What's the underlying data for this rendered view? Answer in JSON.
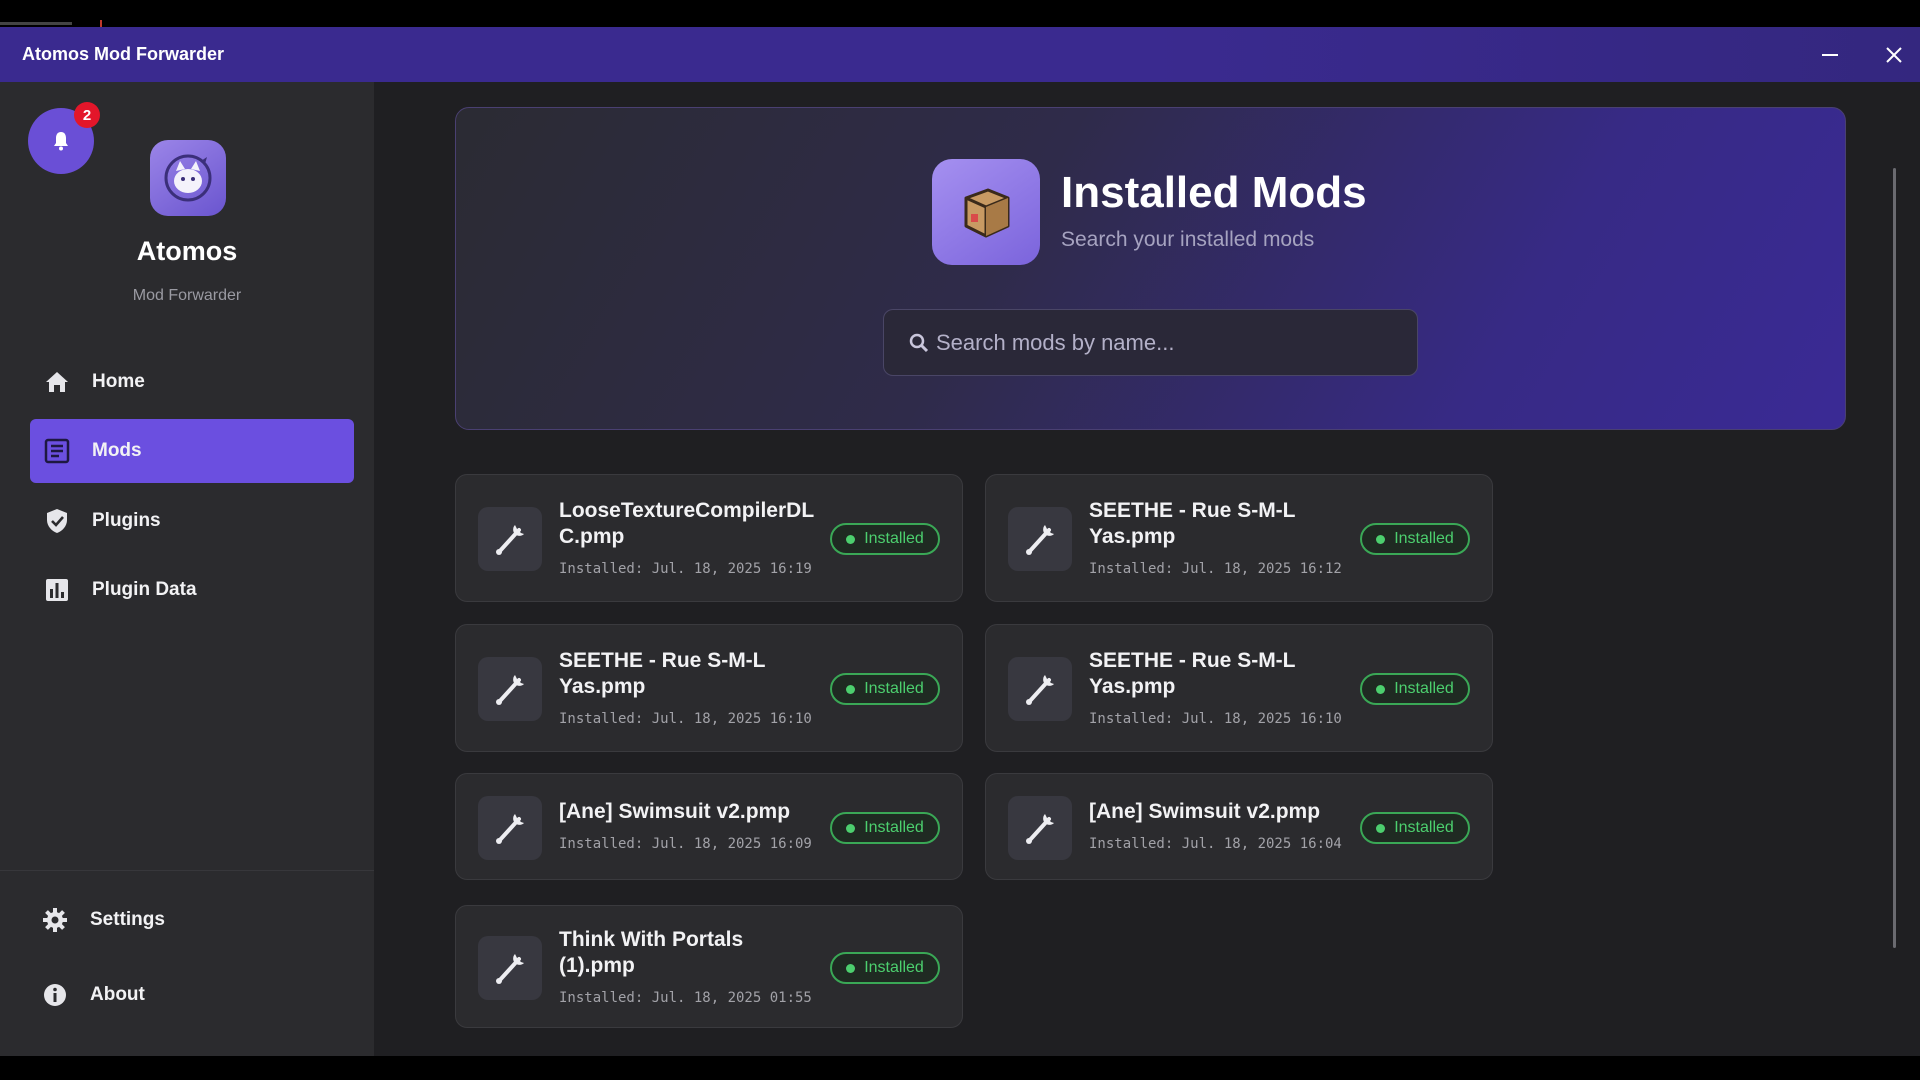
{
  "window": {
    "title": "Atomos Mod Forwarder"
  },
  "sidebar": {
    "notification_count": "2",
    "app_name": "Atomos",
    "app_subtitle": "Mod Forwarder",
    "nav": [
      {
        "label": "Home",
        "icon": "home-icon",
        "active": false
      },
      {
        "label": "Mods",
        "icon": "list-icon",
        "active": true
      },
      {
        "label": "Plugins",
        "icon": "shield-check-icon",
        "active": false
      },
      {
        "label": "Plugin Data",
        "icon": "bar-chart-icon",
        "active": false
      }
    ],
    "footer": [
      {
        "label": "Settings",
        "icon": "gear-icon"
      },
      {
        "label": "About",
        "icon": "info-icon"
      }
    ]
  },
  "hero": {
    "title": "Installed Mods",
    "subtitle": "Search your installed mods",
    "icon": "package-box-icon"
  },
  "search": {
    "placeholder": "Search mods by name...",
    "value": ""
  },
  "mods": [
    {
      "name": "LooseTextureCompilerDLC.pmp",
      "name_lines": [
        "LooseTextureCompilerDL",
        "C.pmp"
      ],
      "installed": "Installed: Jul. 18, 2025 16:19",
      "status": "Installed"
    },
    {
      "name": "SEETHE - Rue S-M-L Yas.pmp",
      "name_lines": [
        "SEETHE - Rue S-M-L",
        "Yas.pmp"
      ],
      "installed": "Installed: Jul. 18, 2025 16:12",
      "status": "Installed"
    },
    {
      "name": "SEETHE - Rue S-M-L Yas.pmp",
      "name_lines": [
        "SEETHE - Rue S-M-L",
        "Yas.pmp"
      ],
      "installed": "Installed: Jul. 18, 2025 16:10",
      "status": "Installed"
    },
    {
      "name": "SEETHE - Rue S-M-L Yas.pmp",
      "name_lines": [
        "SEETHE - Rue S-M-L",
        "Yas.pmp"
      ],
      "installed": "Installed: Jul. 18, 2025 16:10",
      "status": "Installed"
    },
    {
      "name": "[Ane] Swimsuit v2.pmp",
      "name_lines": [
        "[Ane] Swimsuit v2.pmp"
      ],
      "installed": "Installed: Jul. 18, 2025 16:09",
      "status": "Installed"
    },
    {
      "name": "[Ane] Swimsuit v2.pmp",
      "name_lines": [
        "[Ane] Swimsuit v2.pmp"
      ],
      "installed": "Installed: Jul. 18, 2025 16:04",
      "status": "Installed"
    },
    {
      "name": "Think With Portals (1).pmp",
      "name_lines": [
        "Think With Portals",
        "(1).pmp"
      ],
      "installed": "Installed: Jul. 18, 2025 01:55",
      "status": "Installed"
    }
  ],
  "colors": {
    "accent": "#6b4fe0",
    "titlebar": "#3a2a8f",
    "status_green": "#4ccf6e",
    "badge_red": "#e3162a"
  }
}
